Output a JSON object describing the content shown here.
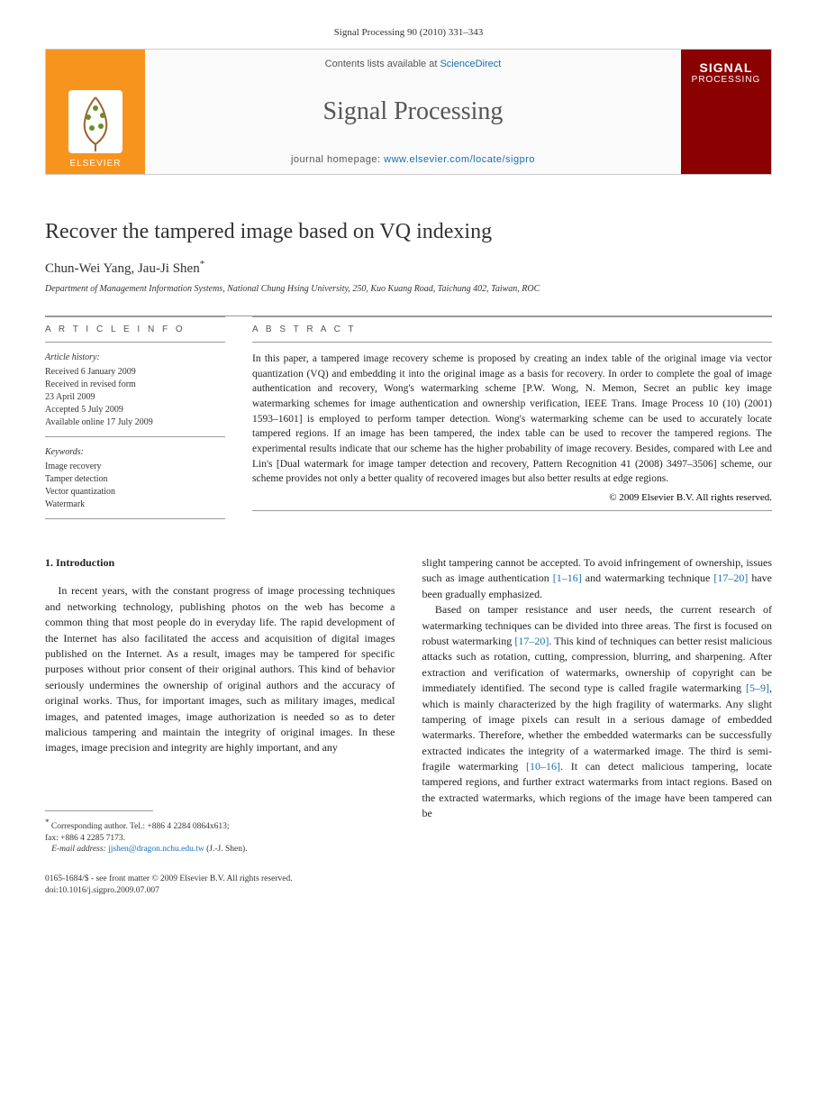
{
  "header": {
    "citation": "Signal Processing 90 (2010) 331–343"
  },
  "banner": {
    "publisher": "ELSEVIER",
    "contents_prefix": "Contents lists available at ",
    "contents_link": "ScienceDirect",
    "journal": "Signal Processing",
    "homepage_prefix": "journal homepage: ",
    "homepage_link": "www.elsevier.com/locate/sigpro",
    "cover_line1": "SIGNAL",
    "cover_line2": "PROCESSING"
  },
  "article": {
    "title": "Recover the tampered image based on VQ indexing",
    "authors": "Chun-Wei Yang, Jau-Ji Shen",
    "corr_marker": "*",
    "affiliation": "Department of Management Information Systems, National Chung Hsing University, 250, Kuo Kuang Road, Taichung 402, Taiwan, ROC"
  },
  "meta": {
    "info_heading": "A R T I C L E  I N F O",
    "abstract_heading": "A B S T R A C T",
    "history_label": "Article history:",
    "received": "Received 6 January 2009",
    "revised1": "Received in revised form",
    "revised2": "23 April 2009",
    "accepted": "Accepted 5 July 2009",
    "online": "Available online 17 July 2009",
    "keywords_label": "Keywords:",
    "keywords": [
      "Image recovery",
      "Tamper detection",
      "Vector quantization",
      "Watermark"
    ]
  },
  "abstract": {
    "text": "In this paper, a tampered image recovery scheme is proposed by creating an index table of the original image via vector quantization (VQ) and embedding it into the original image as a basis for recovery. In order to complete the goal of image authentication and recovery, Wong's watermarking scheme [P.W. Wong, N. Memon, Secret an public key image watermarking schemes for image authentication and ownership verification, IEEE Trans. Image Process 10 (10) (2001) 1593–1601] is employed to perform tamper detection. Wong's watermarking scheme can be used to accurately locate tampered regions. If an image has been tampered, the index table can be used to recover the tampered regions. The experimental results indicate that our scheme has the higher probability of image recovery. Besides, compared with Lee and Lin's [Dual watermark for image tamper detection and recovery, Pattern Recognition 41 (2008) 3497–3506] scheme, our scheme provides not only a better quality of recovered images but also better results at edge regions.",
    "copyright": "© 2009 Elsevier B.V. All rights reserved."
  },
  "body": {
    "section1_heading": "1.  Introduction",
    "col1_para1": "In recent years, with the constant progress of image processing techniques and networking technology, publishing photos on the web has become a common thing that most people do in everyday life. The rapid development of the Internet has also facilitated the access and acquisition of digital images published on the Internet. As a result, images may be tampered for specific purposes without prior consent of their original authors. This kind of behavior seriously undermines the ownership of original authors and the accuracy of original works. Thus, for important images, such as military images, medical images, and patented images, image authorization is needed so as to deter malicious tampering and maintain the integrity of original images. In these images, image precision and integrity are highly important, and any",
    "col2_para1_pre": "slight tampering cannot be accepted. To avoid infringement of ownership, issues such as image authentication ",
    "col2_link1": "[1–16]",
    "col2_para1_mid": " and watermarking technique ",
    "col2_link2": "[17–20]",
    "col2_para1_post": " have been gradually emphasized.",
    "col2_para2_pre": "Based on tamper resistance and user needs, the current research of watermarking techniques can be divided into three areas. The first is focused on robust watermarking ",
    "col2_link3": "[17–20]",
    "col2_para2_mid1": ". This kind of techniques can better resist malicious attacks such as rotation, cutting, compression, blurring, and sharpening. After extraction and verification of watermarks, ownership of copyright can be immediately identified. The second type is called fragile watermarking ",
    "col2_link4": "[5–9]",
    "col2_para2_mid2": ", which is mainly characterized by the high fragility of watermarks. Any slight tampering of image pixels can result in a serious damage of embedded watermarks. Therefore, whether the embedded watermarks can be successfully extracted indicates the integrity of a watermarked image. The third is semi-fragile watermarking ",
    "col2_link5": "[10–16]",
    "col2_para2_post": ". It can detect malicious tampering, locate tampered regions, and further extract watermarks from intact regions. Based on the extracted watermarks, which regions of the image have been tampered can be"
  },
  "footnote": {
    "corr": "Corresponding author. Tel.: +886 4 2284 0864x613;",
    "fax": "fax: +886 4 2285 7173.",
    "email_label": "E-mail address:",
    "email": "jjshen@dragon.nchu.edu.tw",
    "email_who": "(J.-J. Shen)."
  },
  "footer": {
    "line1": "0165-1684/$ - see front matter © 2009 Elsevier B.V. All rights reserved.",
    "line2": "doi:10.1016/j.sigpro.2009.07.007"
  }
}
